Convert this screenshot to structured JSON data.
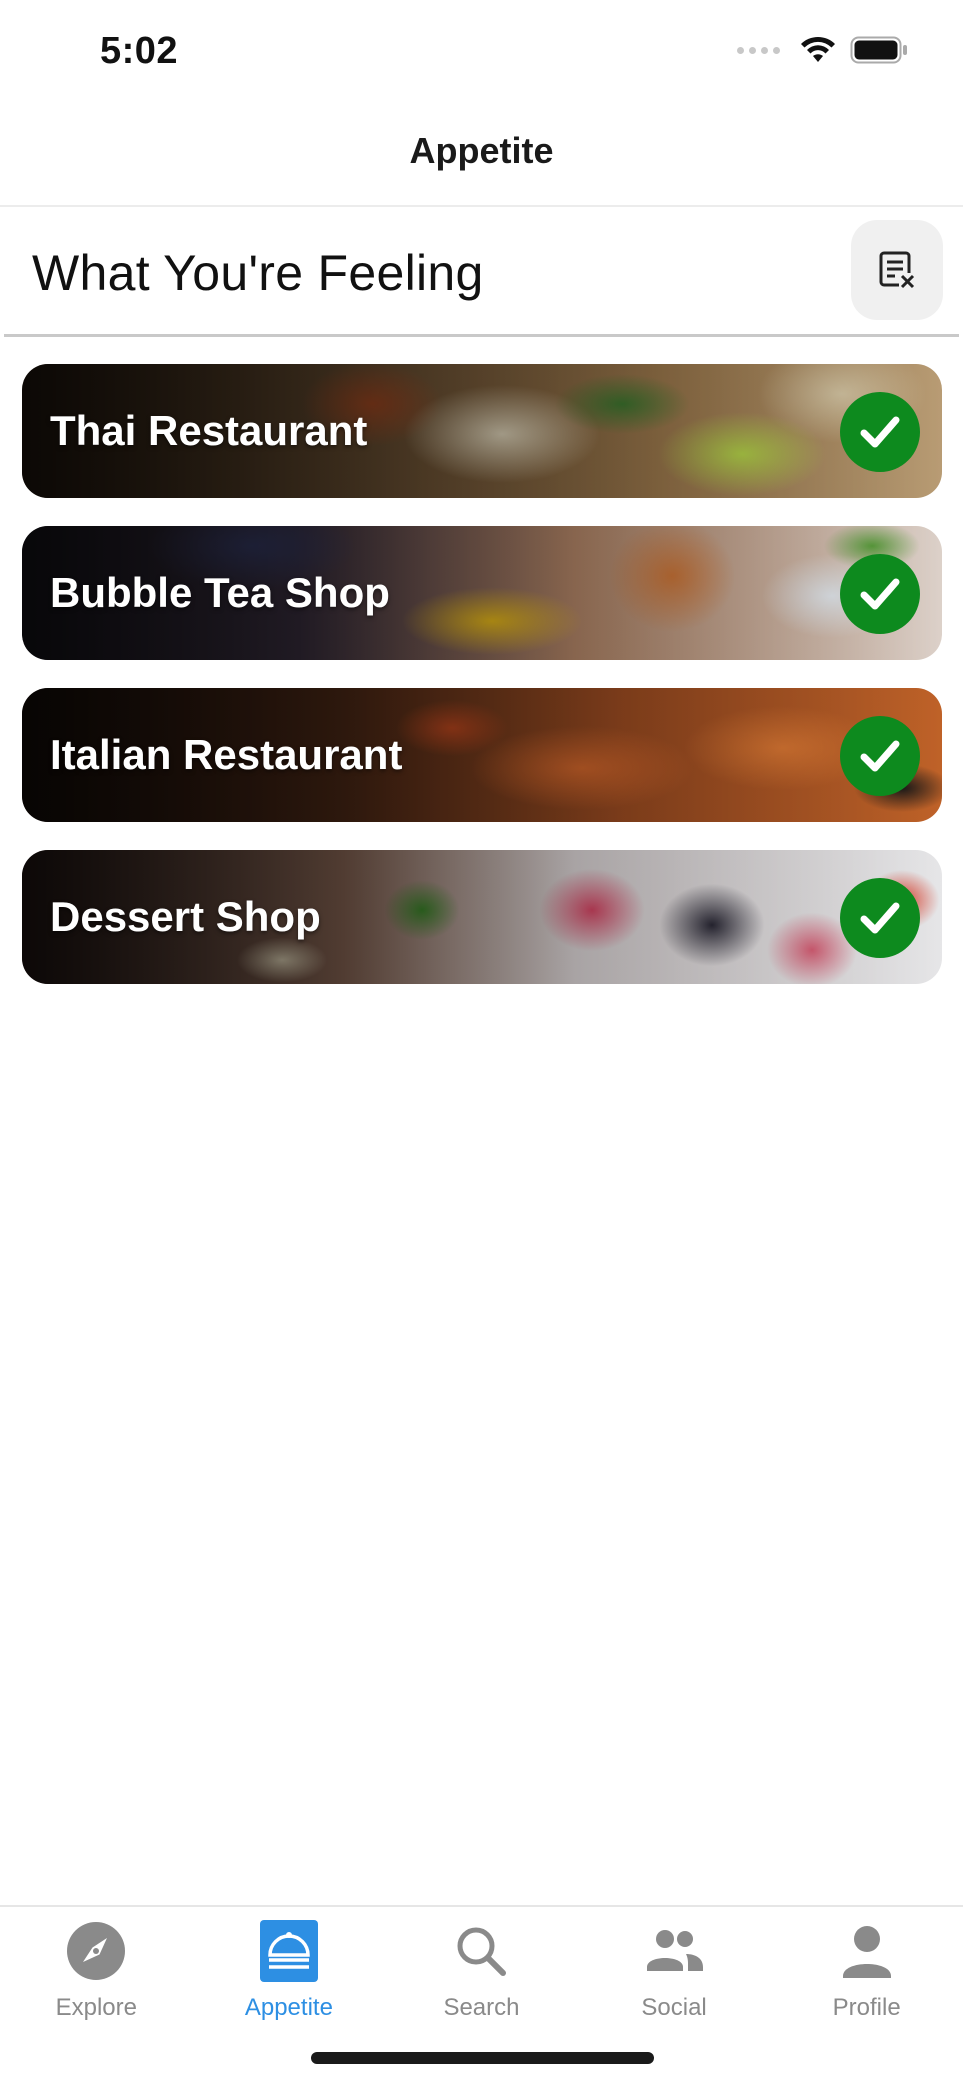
{
  "status_bar": {
    "time": "5:02",
    "icons": [
      "signal-dots-icon",
      "wifi-icon",
      "battery-icon"
    ]
  },
  "nav": {
    "title": "Appetite"
  },
  "section": {
    "title": "What You're Feeling",
    "clear_icon": "clear-list-icon"
  },
  "cards": [
    {
      "label": "Thai Restaurant",
      "selected": true,
      "badge_icon": "checkmark-icon"
    },
    {
      "label": "Bubble Tea Shop",
      "selected": true,
      "badge_icon": "checkmark-icon"
    },
    {
      "label": "Italian Restaurant",
      "selected": true,
      "badge_icon": "checkmark-icon"
    },
    {
      "label": "Dessert Shop",
      "selected": true,
      "badge_icon": "checkmark-icon"
    }
  ],
  "tab_bar": {
    "active": "Appetite",
    "tabs": [
      {
        "label": "Explore",
        "icon": "compass-icon"
      },
      {
        "label": "Appetite",
        "icon": "cloche-icon"
      },
      {
        "label": "Search",
        "icon": "magnifier-icon"
      },
      {
        "label": "Social",
        "icon": "people-icon"
      },
      {
        "label": "Profile",
        "icon": "person-icon"
      }
    ]
  },
  "colors": {
    "accent": "#2d8fe3",
    "check_badge": "#0d8a1e",
    "inactive_tab": "#8a8a8a",
    "clear_button_bg": "#f0f0f0"
  }
}
